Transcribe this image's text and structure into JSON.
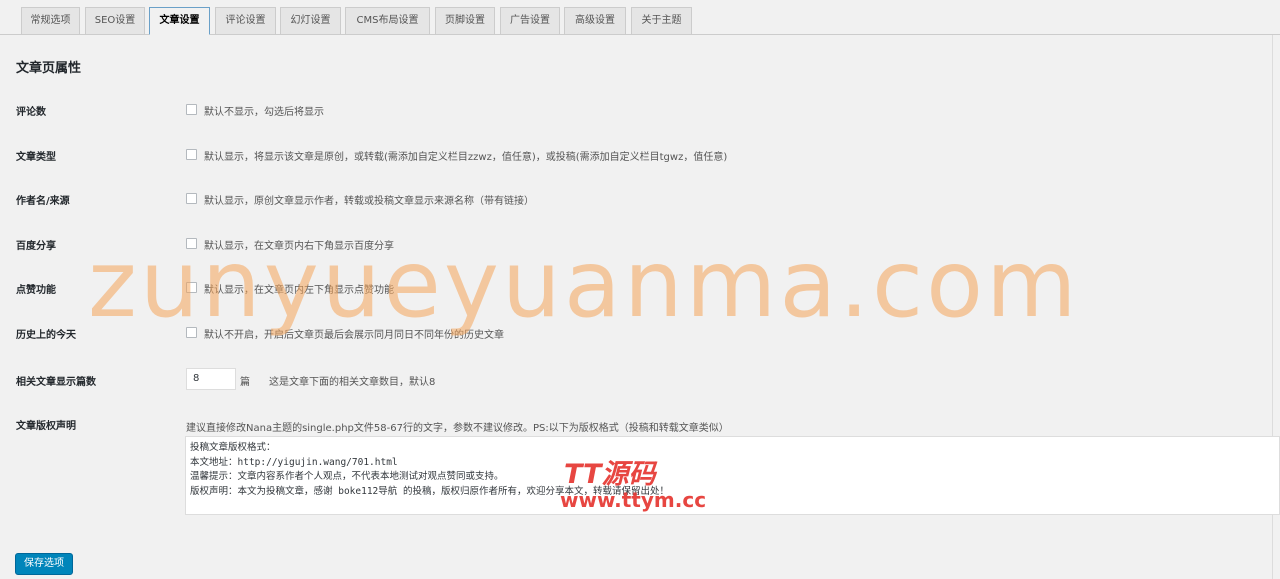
{
  "tabs": [
    {
      "label": "常规选项",
      "active": false
    },
    {
      "label": "SEO设置",
      "active": false
    },
    {
      "label": "文章设置",
      "active": true
    },
    {
      "label": "评论设置",
      "active": false
    },
    {
      "label": "幻灯设置",
      "active": false
    },
    {
      "label": "CMS布局设置",
      "active": false
    },
    {
      "label": "页脚设置",
      "active": false
    },
    {
      "label": "广告设置",
      "active": false
    },
    {
      "label": "高级设置",
      "active": false
    },
    {
      "label": "关于主题",
      "active": false
    }
  ],
  "section_title": "文章页属性",
  "options": [
    {
      "label": "评论数",
      "description": "默认不显示，勾选后将显示",
      "checked": false
    },
    {
      "label": "文章类型",
      "description": "默认显示，将显示该文章是原创，或转载(需添加自定义栏目zzwz，值任意)，或投稿(需添加自定义栏目tgwz，值任意)",
      "checked": false
    },
    {
      "label": "作者名/来源",
      "description": "默认显示，原创文章显示作者，转载或投稿文章显示来源名称（带有链接）",
      "checked": false
    },
    {
      "label": "百度分享",
      "description": "默认显示，在文章页内右下角显示百度分享",
      "checked": false
    },
    {
      "label": "点赞功能",
      "description": "默认显示，在文章页内左下角显示点赞功能",
      "checked": false
    },
    {
      "label": "历史上的今天",
      "description": "默认不开启，开启后文章页最后会展示同月同日不同年份的历史文章",
      "checked": false
    }
  ],
  "related_posts": {
    "label": "相关文章显示篇数",
    "value": "8",
    "unit": "篇",
    "description": "这是文章下面的相关文章数目，默认8"
  },
  "copyright": {
    "label": "文章版权声明",
    "hint": "建议直接修改Nana主题的single.php文件58-67行的文字，参数不建议修改。PS:以下为版权格式（投稿和转载文章类似）",
    "lines": [
      "投稿文章版权格式：",
      "本文地址：http://yigujin.wang/701.html",
      "温馨提示：文章内容系作者个人观点，不代表本地测试对观点赞同或支持。",
      "版权声明：本文为投稿文章，感谢 boke112导航 的投稿，版权归原作者所有，欢迎分享本文，转载请保留出处！"
    ]
  },
  "save_button": "保存选项",
  "watermark": "zunyueyuanma.com",
  "logo_watermark": {
    "top": "TT源码",
    "bottom": "www.ttym.cc"
  },
  "colors": {
    "accent": "#0085ba",
    "watermark": "#f5a55b",
    "logo": "#e5322d"
  }
}
